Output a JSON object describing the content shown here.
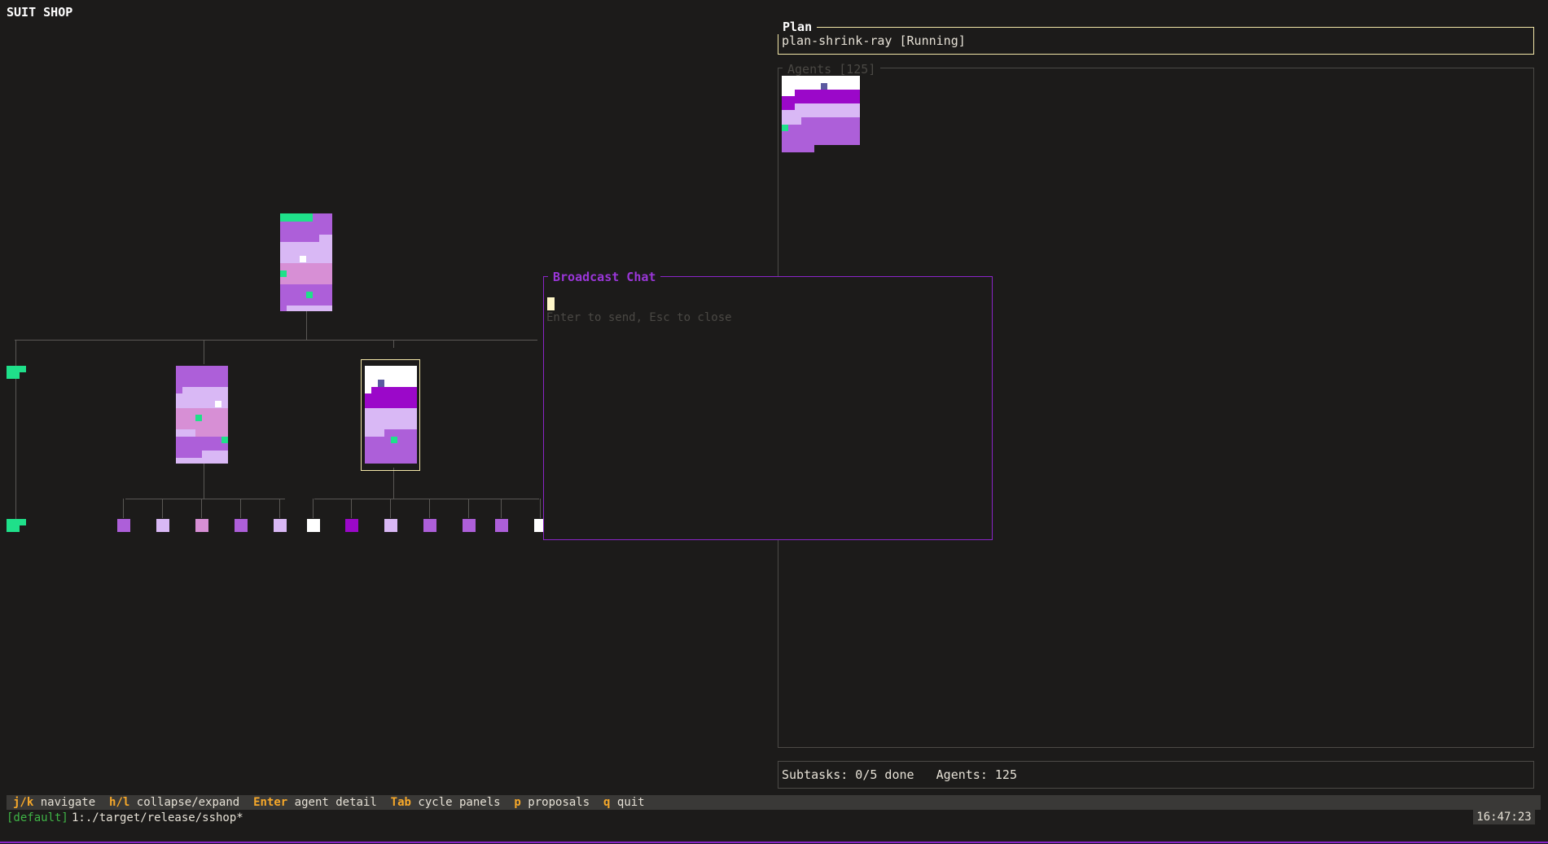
{
  "app": {
    "title": "SUIT SHOP"
  },
  "plan": {
    "title": "Plan",
    "value": "plan-shrink-ray [Running]"
  },
  "agents": {
    "title": "Agents [125]"
  },
  "status": {
    "subtasks": "Subtasks: 0/5 done",
    "agents": "Agents: 125"
  },
  "chat": {
    "title": "Broadcast Chat",
    "placeholder": "Enter to send, Esc to close",
    "value": ""
  },
  "keybar": [
    {
      "key": "j/k",
      "desc": "navigate"
    },
    {
      "key": "h/l",
      "desc": "collapse/expand"
    },
    {
      "key": "Enter",
      "desc": "agent detail"
    },
    {
      "key": "Tab",
      "desc": "cycle panels"
    },
    {
      "key": "p",
      "desc": "proposals"
    },
    {
      "key": "q",
      "desc": "quit"
    }
  ],
  "tmux": {
    "session": "[default]",
    "window": "1:./target/release/sshop*",
    "clock": "16:47:23"
  },
  "colors": {
    "accent": "#8a25c8",
    "selected": "#f2e6a8",
    "key": "#f6a82a",
    "green": "#1fe08a",
    "lavender": "#d9b8f5",
    "purple": "#ad5fd9",
    "magenta": "#9b08c9",
    "pink": "#d78fd5",
    "white": "#ffffff"
  },
  "tree": {
    "leaf_colors": [
      "purple",
      "lavender",
      "pink",
      "purple",
      "lavender",
      "white",
      "magenta",
      "lavender",
      "purple",
      "purple",
      "purple",
      "white"
    ]
  }
}
